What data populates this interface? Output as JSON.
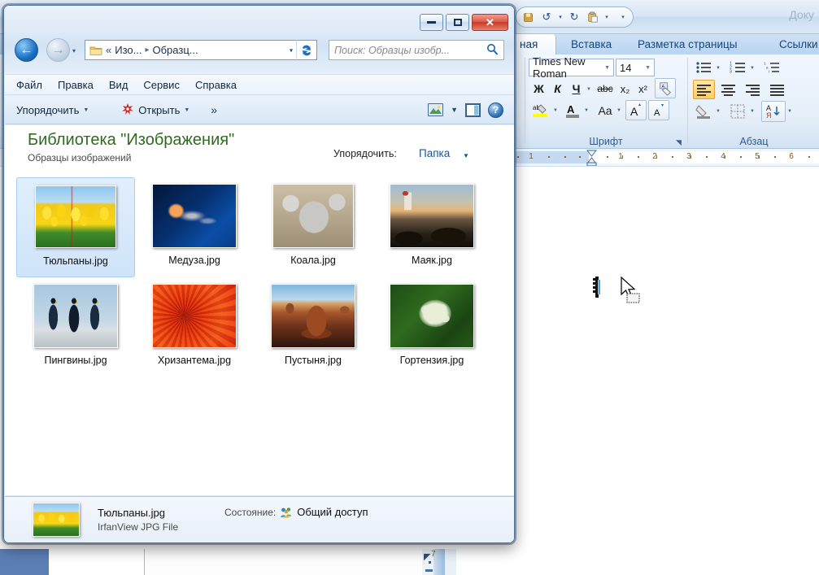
{
  "word": {
    "quick_access": [
      {
        "name": "undo-icon",
        "glyph": "↺"
      },
      {
        "name": "redo-icon",
        "glyph": "↻"
      },
      {
        "name": "paste-icon",
        "glyph": "📋"
      }
    ],
    "qat_more_glyph": "▾",
    "doc_title": "Доку",
    "tabs": [
      {
        "label": "ная",
        "active": true
      },
      {
        "label": "Вставка",
        "active": false
      },
      {
        "label": "Разметка страницы",
        "active": false
      },
      {
        "label": "Ссылки",
        "active": false
      }
    ],
    "font_group": {
      "label": "Шрифт",
      "font_name": "Times New Roman",
      "font_size": "14",
      "bold": "Ж",
      "italic": "К",
      "underline": "Ч",
      "strikethrough": "abc",
      "subscript": "x₂",
      "superscript": "x²",
      "clear_format": "Aa",
      "highlight": "ab",
      "font_color": "A",
      "change_case": "Aa",
      "grow_font": "A",
      "shrink_font": "A",
      "dialog_launcher": "⌐"
    },
    "paragraph_group": {
      "label": "Абзац",
      "bullets": "☰",
      "numbering": "☰",
      "multilevel": "☰",
      "align_left": "≡",
      "align_center": "≡",
      "align_right": "≡",
      "justify": "≡",
      "shading": "◧",
      "borders": "⊞",
      "sort": "AЯ"
    },
    "ruler": {
      "left_numbers": [
        "1"
      ],
      "numbers": [
        "1",
        "2",
        "3",
        "4",
        "5",
        "6"
      ]
    },
    "vertical_ruler_number": "7"
  },
  "explorer": {
    "window_controls": {
      "minimize": "minimize",
      "maximize": "maximize",
      "close": "✕"
    },
    "navigation": {
      "back_glyph": "←",
      "forward_glyph": "→",
      "history_glyph": "▾",
      "refresh_glyph": "↻"
    },
    "address": {
      "overflow": "«",
      "segments": [
        "Изо...",
        "Образц..."
      ],
      "separator": "▸",
      "dropdown_glyph": "▾"
    },
    "search": {
      "placeholder": "Поиск: Образцы изобр...",
      "icon": "search-icon"
    },
    "menu": [
      "Файл",
      "Правка",
      "Вид",
      "Сервис",
      "Справка"
    ],
    "commandbar": {
      "organize": "Упорядочить",
      "open": "Открыть",
      "overflow": "»",
      "caret": "▼"
    },
    "library": {
      "title": "Библиотека \"Изображения\"",
      "subtitle": "Образцы изображений",
      "arrange_label": "Упорядочить:",
      "arrange_value": "Папка",
      "arrange_caret": "▼"
    },
    "files": [
      {
        "name": "Тюльпаны.jpg",
        "art": "tulips",
        "selected": true
      },
      {
        "name": "Медуза.jpg",
        "art": "jellyfish",
        "selected": false
      },
      {
        "name": "Коала.jpg",
        "art": "koala",
        "selected": false
      },
      {
        "name": "Маяк.jpg",
        "art": "lighthouse",
        "selected": false
      },
      {
        "name": "Пингвины.jpg",
        "art": "penguins",
        "selected": false
      },
      {
        "name": "Хризантема.jpg",
        "art": "chrysanthemum",
        "selected": false
      },
      {
        "name": "Пустыня.jpg",
        "art": "desert",
        "selected": false
      },
      {
        "name": "Гортензия.jpg",
        "art": "hydrangea",
        "selected": false
      }
    ],
    "details": {
      "file_name": "Тюльпаны.jpg",
      "file_type": "IrfanView JPG File",
      "status_label": "Состояние:",
      "status_value": "Общий доступ",
      "status_icon": "share-users-icon"
    }
  },
  "colors": {
    "accent_blue": "#15559b",
    "library_green": "#2e6b1f",
    "selection_blue": "#cfe4fa",
    "close_red": "#c93827",
    "word_ribbon_blue": "#b9d4ef"
  }
}
